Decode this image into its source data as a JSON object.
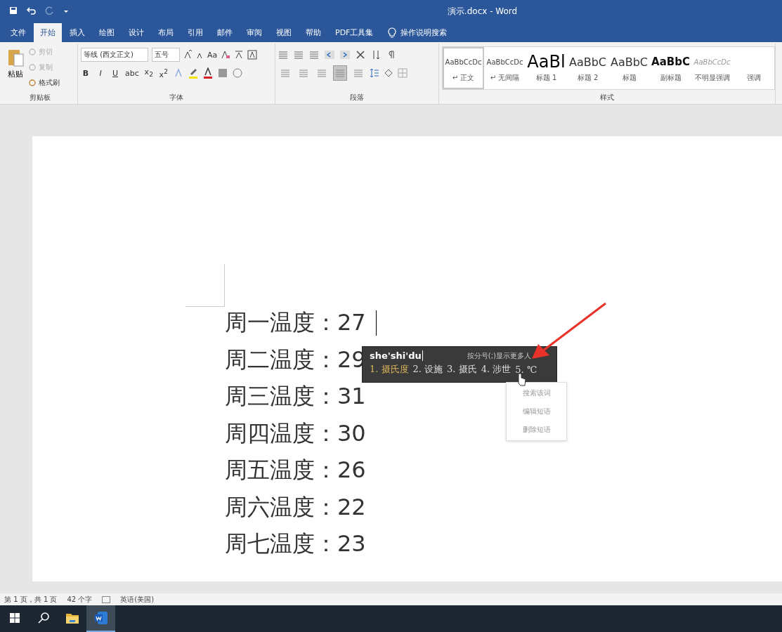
{
  "window": {
    "title": "演示.docx - Word"
  },
  "tabs": [
    {
      "label": "文件",
      "selected": false
    },
    {
      "label": "开始",
      "selected": true
    },
    {
      "label": "插入",
      "selected": false
    },
    {
      "label": "绘图",
      "selected": false
    },
    {
      "label": "设计",
      "selected": false
    },
    {
      "label": "布局",
      "selected": false
    },
    {
      "label": "引用",
      "selected": false
    },
    {
      "label": "邮件",
      "selected": false
    },
    {
      "label": "审阅",
      "selected": false
    },
    {
      "label": "视图",
      "selected": false
    },
    {
      "label": "帮助",
      "selected": false
    },
    {
      "label": "PDF工具集",
      "selected": false
    }
  ],
  "search": {
    "placeholder": "操作说明搜索"
  },
  "clipboard": {
    "title": "剪贴板",
    "paste": "粘贴",
    "items": [
      {
        "label": "剪切",
        "disabled": true
      },
      {
        "label": "复制",
        "disabled": true
      },
      {
        "label": "格式刷",
        "disabled": false
      }
    ]
  },
  "font": {
    "title": "字体",
    "font_name": "等线 (西文正文)",
    "font_size": "五号",
    "case_button": "Aa",
    "format_buttons": [
      "B",
      "I",
      "U",
      "abc",
      "x$_{2}$",
      "x$^{2}$"
    ]
  },
  "paragraph": {
    "title": "段落",
    "alignment": [
      {
        "selected": false
      },
      {
        "selected": false
      },
      {
        "selected": false
      },
      {
        "selected": true
      },
      {
        "selected": false
      }
    ]
  },
  "styles": {
    "title": "样式",
    "items": [
      {
        "kind": "body",
        "preview": "AaBbCcDc",
        "name": "↵ 正文",
        "selected": true
      },
      {
        "kind": "body",
        "preview": "AaBbCcDc",
        "name": "↵ 无间隔",
        "selected": false
      },
      {
        "kind": "heading1",
        "preview": "AaBl",
        "name": "标题 1",
        "selected": false
      },
      {
        "kind": "heading2",
        "preview": "AaBbC",
        "name": "标题 2",
        "selected": false
      },
      {
        "kind": "heading2",
        "preview": "AaBbC",
        "name": "标题",
        "selected": false
      },
      {
        "kind": "subtitle",
        "preview": "AaBbC",
        "name": "副标题",
        "selected": false
      },
      {
        "kind": "subtle",
        "preview": "AaBbCcDc",
        "name": "不明显强调",
        "selected": false
      },
      {
        "name": "强调",
        "selected": false
      }
    ]
  },
  "document": {
    "lines": [
      "周一温度：27",
      "周二温度：29",
      "周三温度：31",
      "周四温度：30",
      "周五温度：26",
      "周六温度：22",
      "周七温度：23"
    ]
  },
  "ime": {
    "composition": "she'shi'du",
    "hint": "按分号(;)显示更多人",
    "candidates": [
      {
        "index": "1.",
        "text": "摄氏度",
        "selected": true
      },
      {
        "index": "2.",
        "text": "设施",
        "selected": false
      },
      {
        "index": "3.",
        "text": "摄氏",
        "selected": false
      },
      {
        "index": "4.",
        "text": "涉世",
        "selected": false
      },
      {
        "index": "5.",
        "text": "℃",
        "selected": false
      }
    ]
  },
  "context_menu": {
    "items": [
      "搜索该词",
      "编辑短语",
      "删除短语"
    ]
  },
  "status_bar": {
    "items": [
      "第 1 页，共 1 页",
      "42 个字",
      "英语(美国)"
    ]
  },
  "taskbar": {
    "items": [
      {
        "kind": "start",
        "selected": false
      },
      {
        "kind": "search",
        "selected": false
      },
      {
        "kind": "explorer",
        "selected": false
      },
      {
        "kind": "word",
        "selected": true
      }
    ]
  }
}
